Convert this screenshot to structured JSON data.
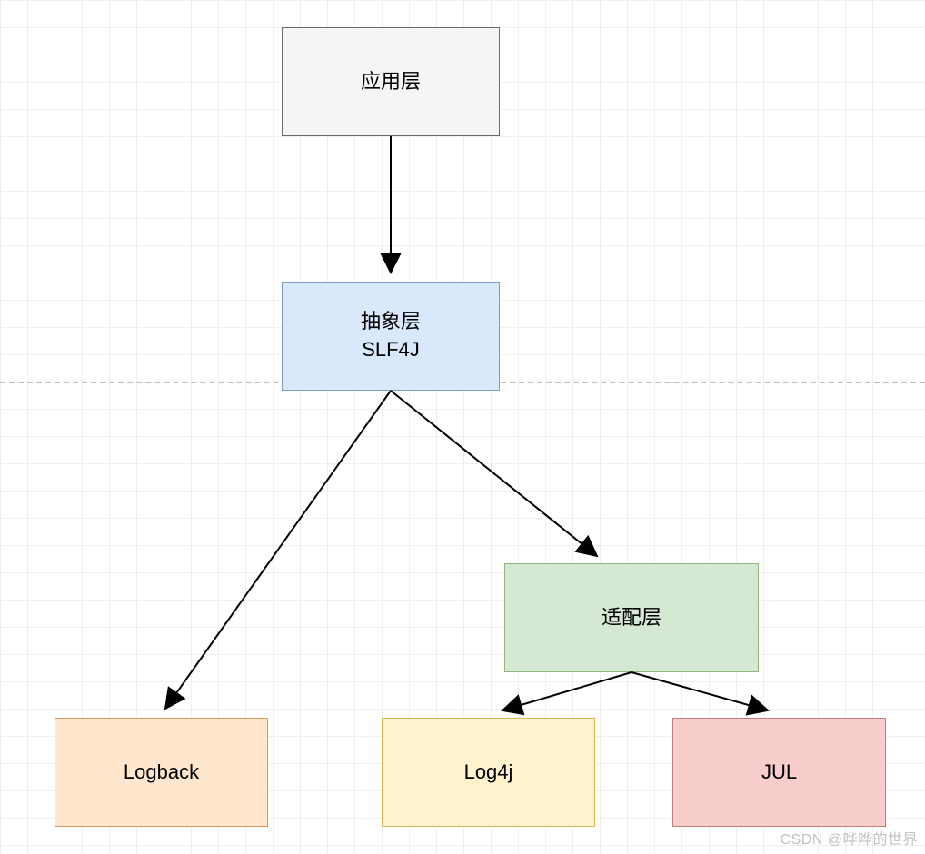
{
  "nodes": {
    "app": {
      "label": "应用层"
    },
    "abstract": {
      "line1": "抽象层",
      "line2": "SLF4J"
    },
    "adapter": {
      "label": "适配层"
    },
    "logback": {
      "label": "Logback"
    },
    "log4j": {
      "label": "Log4j"
    },
    "jul": {
      "label": "JUL"
    }
  },
  "watermark": "CSDN @哗哗的世界",
  "colors": {
    "app_bg": "#f5f5f5",
    "abstract_bg": "#dae8fc",
    "adapter_bg": "#d5e8d4",
    "logback_bg": "#ffe6cc",
    "log4j_bg": "#fff2cc",
    "jul_bg": "#f8cecc"
  }
}
